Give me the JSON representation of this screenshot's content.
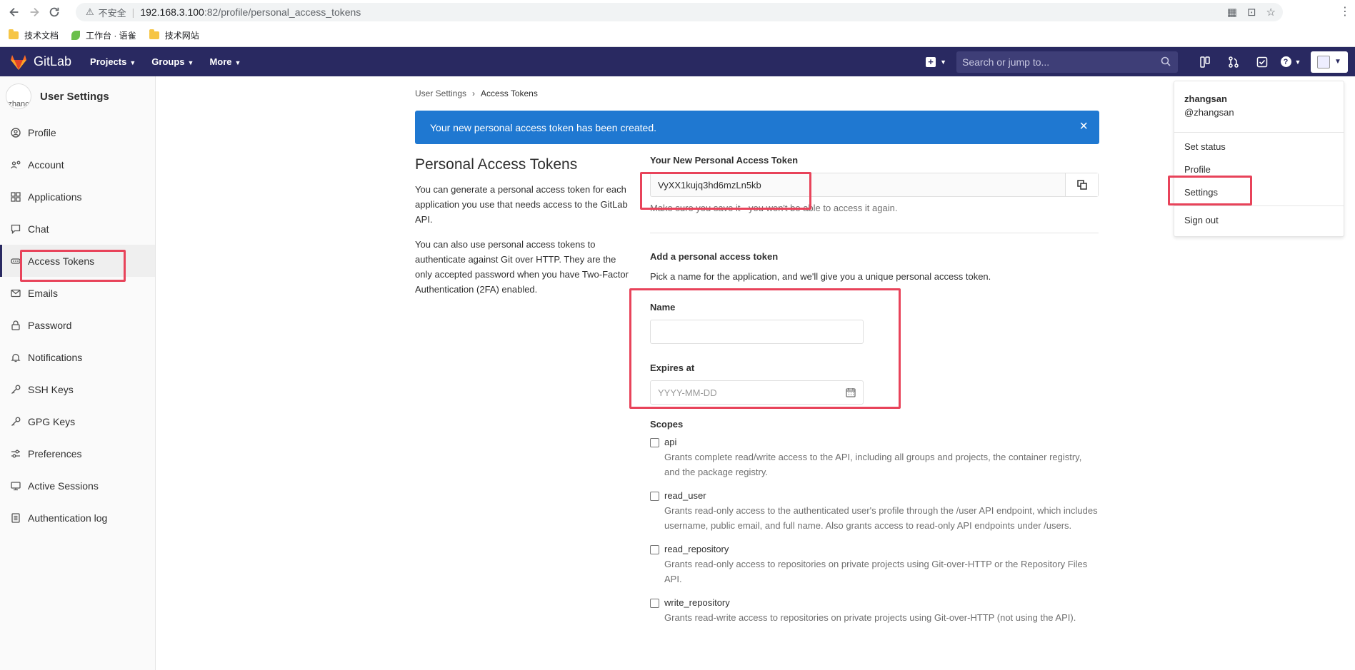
{
  "browser": {
    "insecure_label": "不安全",
    "url_host": "192.168.3.100",
    "url_path": ":82/profile/personal_access_tokens",
    "bookmarks": [
      {
        "label": "技术文档"
      },
      {
        "label": "工作台 · 语雀"
      },
      {
        "label": "技术网站"
      }
    ]
  },
  "header": {
    "brand": "GitLab",
    "menu": [
      "Projects",
      "Groups",
      "More"
    ],
    "search_placeholder": "Search or jump to..."
  },
  "sidebar": {
    "avatar_text": "zhanc",
    "title": "User Settings",
    "items": [
      {
        "label": "Profile",
        "icon": "profile-icon"
      },
      {
        "label": "Account",
        "icon": "account-icon"
      },
      {
        "label": "Applications",
        "icon": "applications-icon"
      },
      {
        "label": "Chat",
        "icon": "chat-icon"
      },
      {
        "label": "Access Tokens",
        "icon": "token-icon",
        "active": true
      },
      {
        "label": "Emails",
        "icon": "mail-icon"
      },
      {
        "label": "Password",
        "icon": "lock-icon"
      },
      {
        "label": "Notifications",
        "icon": "bell-icon"
      },
      {
        "label": "SSH Keys",
        "icon": "key-icon"
      },
      {
        "label": "GPG Keys",
        "icon": "key-icon"
      },
      {
        "label": "Preferences",
        "icon": "preferences-icon"
      },
      {
        "label": "Active Sessions",
        "icon": "monitor-icon"
      },
      {
        "label": "Authentication log",
        "icon": "log-icon"
      }
    ]
  },
  "breadcrumb": {
    "parent": "User Settings",
    "current": "Access Tokens"
  },
  "flash": {
    "message": "Your new personal access token has been created.",
    "close": "×"
  },
  "intro": {
    "title": "Personal Access Tokens",
    "p1": "You can generate a personal access token for each application you use that needs access to the GitLab API.",
    "p2": "You can also use personal access tokens to authenticate against Git over HTTP. They are the only accepted password when you have Two-Factor Authentication (2FA) enabled."
  },
  "new_token": {
    "label": "Your New Personal Access Token",
    "value": "VyXX1kujq3hd6mzLn5kb",
    "hint": "Make sure you save it - you won't be able to access it again."
  },
  "form": {
    "title": "Add a personal access token",
    "subtitle": "Pick a name for the application, and we'll give you a unique personal access token.",
    "name_label": "Name",
    "name_value": "",
    "expires_label": "Expires at",
    "expires_placeholder": "YYYY-MM-DD",
    "scopes_label": "Scopes",
    "scopes": [
      {
        "name": "api",
        "desc": "Grants complete read/write access to the API, including all groups and projects, the container registry, and the package registry."
      },
      {
        "name": "read_user",
        "desc": "Grants read-only access to the authenticated user's profile through the /user API endpoint, which includes username, public email, and full name. Also grants access to read-only API endpoints under /users."
      },
      {
        "name": "read_repository",
        "desc": "Grants read-only access to repositories on private projects using Git-over-HTTP or the Repository Files API."
      },
      {
        "name": "write_repository",
        "desc": "Grants read-write access to repositories on private projects using Git-over-HTTP (not using the API)."
      }
    ]
  },
  "user_menu": {
    "name": "zhangsan",
    "handle": "@zhangsan",
    "items": [
      "Set status",
      "Profile",
      "Settings",
      "Sign out"
    ]
  },
  "colors": {
    "header_bg": "#292961",
    "flash_bg": "#1f78d1",
    "annotation": "#e8435a"
  }
}
